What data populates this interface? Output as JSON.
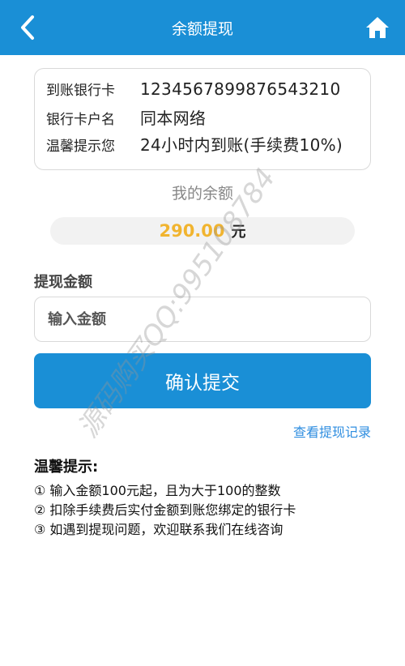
{
  "header": {
    "title": "余额提现",
    "back_icon": "chevron-left-icon",
    "home_icon": "home-icon"
  },
  "bank": {
    "rows": [
      {
        "label": "到账银行卡",
        "value": "1234567899876543210"
      },
      {
        "label": "银行卡户名",
        "value": "同本网络"
      },
      {
        "label": "温馨提示您",
        "value": "24小时内到账(手续费10%)"
      }
    ]
  },
  "balance": {
    "label": "我的余额",
    "amount": "290.00",
    "unit": "元"
  },
  "withdraw": {
    "label": "提现金额",
    "placeholder": "输入金额",
    "submit_label": "确认提交",
    "records_link": "查看提现记录"
  },
  "tips": {
    "title": "温馨提示:",
    "items": [
      "① 输入金额100元起，且为大于100的整数",
      "② 扣除手续费后实付金额到账您绑定的银行卡",
      "③ 如遇到提现问题，欢迎联系我们在线咨询"
    ]
  },
  "watermark": "源码购买QQ:995108784",
  "colors": {
    "primary": "#1a8fd6",
    "balance_amount": "#f1b42f",
    "link": "#2f8ee0"
  }
}
